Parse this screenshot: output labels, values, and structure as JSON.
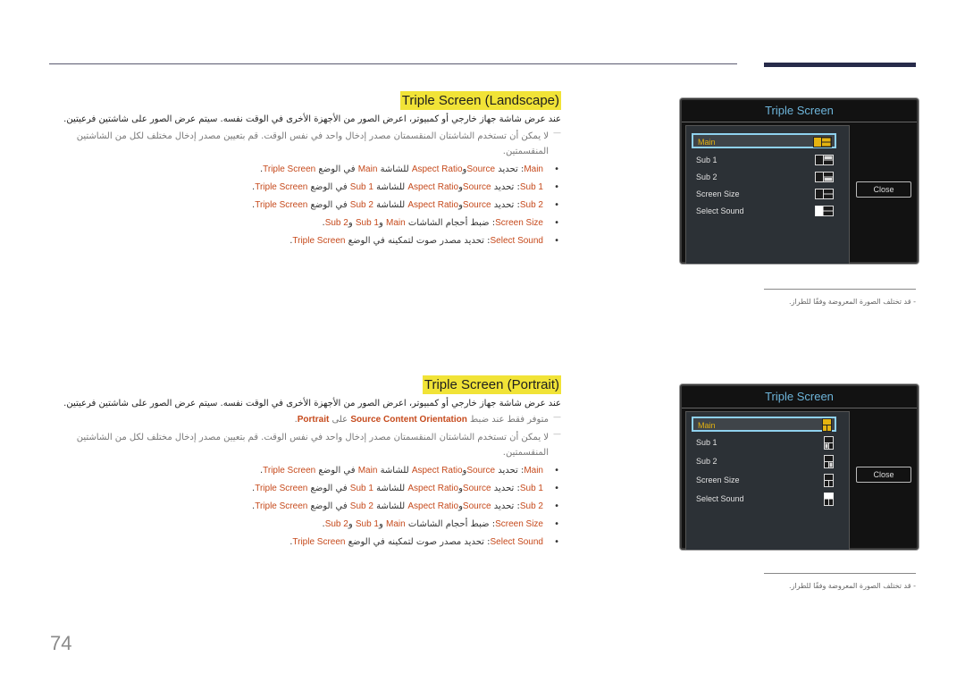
{
  "page_number": "74",
  "colors": {
    "highlight_title_bg": "#f1e337",
    "term": "#c64a1c",
    "osd_title": "#6db4d9",
    "osd_selected_text": "#e5b310",
    "osd_selected_border": "#8fd1ee"
  },
  "landscape": {
    "title": "Triple Screen (Landscape)",
    "intro": "عند عرض شاشة جهاز خارجي أو كمبيوتر، اعرض الصور من الأجهزة الأخرى في الوقت نفسه. سيتم عرض الصور على شاشتين فرعيتين.",
    "notes": [
      {
        "text": "لا يمكن أن تستخدم الشاشتان المنقسمتان مصدر إدخال واحد في نفس الوقت. قم بتعيين مصدر إدخال مختلف لكل من الشاشتين المنقسمتين."
      }
    ],
    "bullets": [
      {
        "term": "Main",
        "sep": ": تحديد ",
        "a": "Source",
        "w": "و",
        "b": "Aspect Ratio",
        "mid": " للشاشة ",
        "c": "Main",
        "mid2": " في الوضع ",
        "d": "Triple Screen",
        "end": "."
      },
      {
        "term": "Sub 1",
        "sep": ": تحديد ",
        "a": "Source",
        "w": "و",
        "b": "Aspect Ratio",
        "mid": " للشاشة ",
        "c": "Sub 1",
        "mid2": " في الوضع ",
        "d": "Triple Screen",
        "end": "."
      },
      {
        "term": "Sub 2",
        "sep": ": تحديد ",
        "a": "Source",
        "w": "و",
        "b": "Aspect Ratio",
        "mid": " للشاشة ",
        "c": "Sub 2",
        "mid2": " في الوضع ",
        "d": "Triple Screen",
        "end": "."
      }
    ],
    "size_bullet": {
      "term": "Screen Size",
      "sep": ": ضبط أحجام الشاشات ",
      "a": "Main",
      "w1": " و",
      "b": "Sub 1",
      "w2": " و",
      "c": "Sub 2",
      "end": "."
    },
    "sound_bullet": {
      "term": "Select Sound",
      "sep": ": تحديد مصدر صوت لتمكينه في الوضع ",
      "a": "Triple Screen",
      "end": "."
    },
    "osd": {
      "title": "Triple Screen",
      "items": [
        "Main",
        "Sub 1",
        "Sub 2",
        "Screen Size",
        "Select Sound"
      ],
      "selected": "Main",
      "icons": [
        "layout-landscape-main-icon",
        "layout-landscape-sub1-icon",
        "layout-landscape-sub2-icon",
        "layout-landscape-size-icon",
        "layout-landscape-sound-icon"
      ],
      "close_label": "Close"
    },
    "footnote": "-  قد تختلف الصورة المعروضة وفقًا للطراز."
  },
  "portrait": {
    "title": "Triple Screen (Portrait)",
    "intro": "عند عرض شاشة جهاز خارجي أو كمبيوتر، اعرض الصور من الأجهزة الأخرى في الوقت نفسه. سيتم عرض الصور على شاشتين فرعيتين.",
    "avail_note": {
      "pre": "متوفر فقط عند ضبط ",
      "a": "Source Content Orientation",
      "mid": " على ",
      "b": "Portrait",
      "end": "."
    },
    "notes": [
      {
        "text": "لا يمكن أن تستخدم الشاشتان المنقسمتان مصدر إدخال واحد في نفس الوقت. قم بتعيين مصدر إدخال مختلف لكل من الشاشتين المنقسمتين."
      }
    ],
    "bullets": [
      {
        "term": "Main",
        "sep": ": تحديد ",
        "a": "Source",
        "w": "و",
        "b": "Aspect Ratio",
        "mid": " للشاشة ",
        "c": "Main",
        "mid2": " في الوضع ",
        "d": "Triple Screen",
        "end": "."
      },
      {
        "term": "Sub 1",
        "sep": ": تحديد ",
        "a": "Source",
        "w": "و",
        "b": "Aspect Ratio",
        "mid": " للشاشة ",
        "c": "Sub 1",
        "mid2": " في الوضع ",
        "d": "Triple Screen",
        "end": "."
      },
      {
        "term": "Sub 2",
        "sep": ": تحديد ",
        "a": "Source",
        "w": "و",
        "b": "Aspect Ratio",
        "mid": " للشاشة ",
        "c": "Sub 2",
        "mid2": " في الوضع ",
        "d": "Triple Screen",
        "end": "."
      }
    ],
    "size_bullet": {
      "term": "Screen Size",
      "sep": ": ضبط أحجام الشاشات ",
      "a": "Main",
      "w1": " و",
      "b": "Sub 1",
      "w2": " و",
      "c": "Sub 2",
      "end": "."
    },
    "sound_bullet": {
      "term": "Select Sound",
      "sep": ": تحديد مصدر صوت لتمكينه في الوضع ",
      "a": "Triple Screen",
      "end": "."
    },
    "osd": {
      "title": "Triple Screen",
      "items": [
        "Main",
        "Sub 1",
        "Sub 2",
        "Screen Size",
        "Select Sound"
      ],
      "selected": "Main",
      "icons": [
        "layout-portrait-main-icon",
        "layout-portrait-sub1-icon",
        "layout-portrait-sub2-icon",
        "layout-portrait-size-icon",
        "layout-portrait-sound-icon"
      ],
      "close_label": "Close"
    },
    "footnote": "-  قد تختلف الصورة المعروضة وفقًا للطراز."
  }
}
